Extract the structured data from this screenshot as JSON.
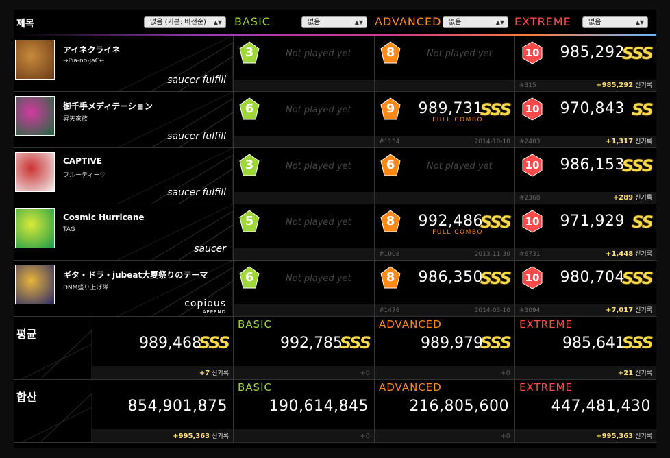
{
  "colors": {
    "basic": "#9fd63a",
    "advanced": "#ff8a1a",
    "extreme": "#ff4a4a",
    "grade": "#f6d84a",
    "new_record": "#ffe07a"
  },
  "header": {
    "title": "제목",
    "sort_select": "없음 (기본: 버전순)",
    "basic_label": "BASIC",
    "basic_select": "없음",
    "advanced_label": "ADVANCED",
    "advanced_select": "없음",
    "extreme_label": "EXTREME",
    "extreme_select": "없음"
  },
  "songs": [
    {
      "title": "アイネクライネ",
      "artist": "→Pia-no-jaC←",
      "version": "saucer fulfill",
      "basic": {
        "level": "3",
        "status": "Not played yet"
      },
      "advanced": {
        "level": "8",
        "status": "Not played yet"
      },
      "extreme": {
        "level": "10",
        "score": "985,292",
        "grade": "SSS",
        "rank": "#315",
        "new_record": "+985,292",
        "new_record_label": "신기록"
      }
    },
    {
      "title": "御千手メディテーション",
      "artist": "昇天家族",
      "version": "saucer fulfill",
      "basic": {
        "level": "6",
        "status": "Not played yet"
      },
      "advanced": {
        "level": "9",
        "score": "989,731",
        "grade": "SSS",
        "full_combo": "FULL COMBO",
        "rank": "#1134",
        "date": "2014-10-10"
      },
      "extreme": {
        "level": "10",
        "score": "970,843",
        "grade": "SS",
        "rank": "#2483",
        "new_record": "+1,317",
        "new_record_label": "신기록"
      }
    },
    {
      "title": "CAPTIVE",
      "artist": "フルーティー♡",
      "version": "saucer fulfill",
      "basic": {
        "level": "3",
        "status": "Not played yet"
      },
      "advanced": {
        "level": "6",
        "status": "Not played yet"
      },
      "extreme": {
        "level": "10",
        "score": "986,153",
        "grade": "SSS",
        "rank": "#2368",
        "new_record": "+289",
        "new_record_label": "신기록"
      }
    },
    {
      "title": "Cosmic Hurricane",
      "artist": "TAG",
      "version": "saucer",
      "basic": {
        "level": "5",
        "status": "Not played yet"
      },
      "advanced": {
        "level": "8",
        "score": "992,486",
        "grade": "SSS",
        "full_combo": "FULL COMBO",
        "rank": "#1008",
        "date": "2013-11-30"
      },
      "extreme": {
        "level": "10",
        "score": "971,929",
        "grade": "SS",
        "rank": "#6731",
        "new_record": "+1,448",
        "new_record_label": "신기록"
      }
    },
    {
      "title": "ギタ・ドラ・jubeat大夏祭りのテーマ",
      "artist": "DNM盛り上げ隊",
      "version": "copious",
      "version_sub": "APPEND",
      "basic": {
        "level": "6",
        "status": "Not played yet"
      },
      "advanced": {
        "level": "8",
        "score": "986,350",
        "grade": "SSS",
        "rank": "#1478",
        "date": "2014-03-10"
      },
      "extreme": {
        "level": "10",
        "score": "980,704",
        "grade": "SSS",
        "rank": "#3094",
        "new_record": "+7,017",
        "new_record_label": "신기록"
      }
    }
  ],
  "average": {
    "label": "평균",
    "total": {
      "score": "989,468",
      "grade": "SSS",
      "delta": "+7",
      "delta_label": "신기록"
    },
    "basic": {
      "name": "BASIC",
      "score": "992,785",
      "grade": "SSS",
      "delta": "+0"
    },
    "advanced": {
      "name": "ADVANCED",
      "score": "989,979",
      "grade": "SSS",
      "delta": "+0"
    },
    "extreme": {
      "name": "EXTREME",
      "score": "985,641",
      "grade": "SSS",
      "delta": "+21",
      "delta_label": "신기록"
    }
  },
  "total": {
    "label": "합산",
    "total": {
      "score": "854,901,875",
      "delta": "+995,363",
      "delta_label": "신기록"
    },
    "basic": {
      "name": "BASIC",
      "score": "190,614,845",
      "delta": "+0"
    },
    "advanced": {
      "name": "ADVANCED",
      "score": "216,805,600",
      "delta": "+0"
    },
    "extreme": {
      "name": "EXTREME",
      "score": "447,481,430",
      "delta": "+995,363",
      "delta_label": "신기록"
    }
  }
}
